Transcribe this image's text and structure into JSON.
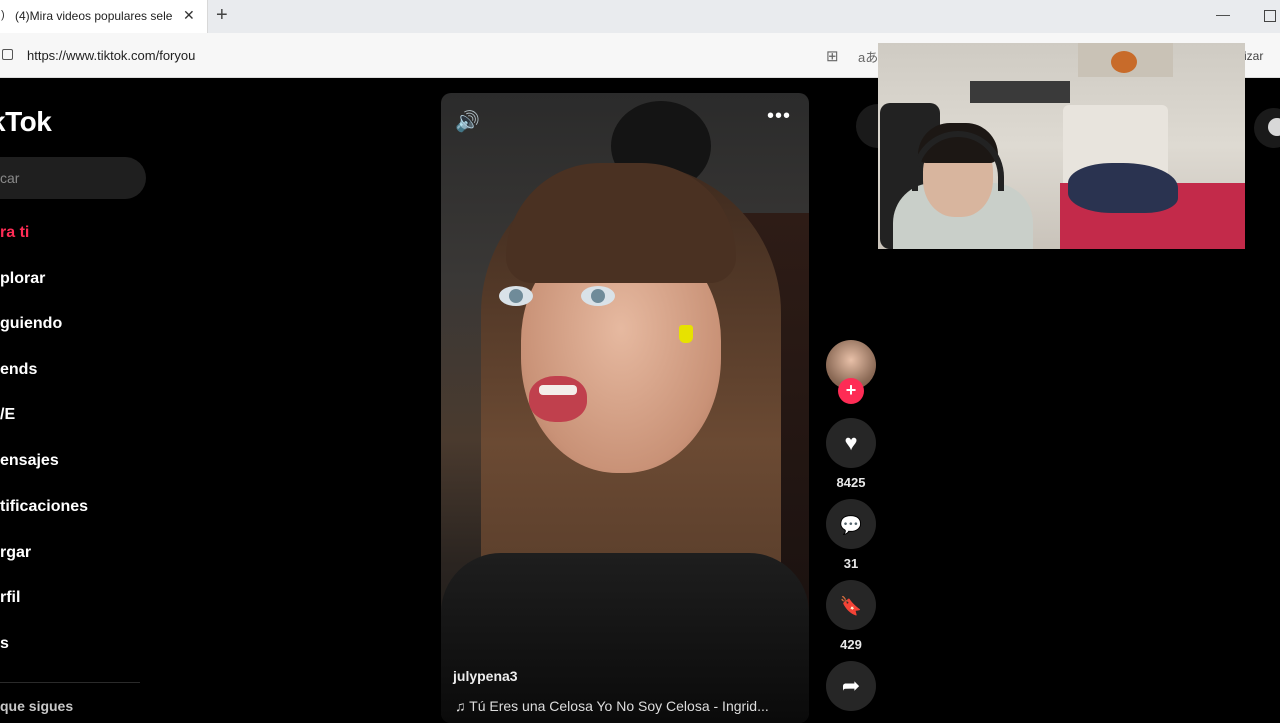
{
  "browser": {
    "tab_title": "(4)Mira videos populares sele",
    "tab_close": "✕",
    "new_tab": "+",
    "url": "https://www.tiktok.com/foryou",
    "ext_reader": "aあ",
    "right_partial": "izar"
  },
  "tiktok": {
    "logo": "kTok",
    "search_placeholder": "car",
    "nav": [
      {
        "label": "ra ti"
      },
      {
        "label": "plorar"
      },
      {
        "label": "guiendo"
      },
      {
        "label": "ends"
      },
      {
        "label": "/E"
      },
      {
        "label": "ensajes"
      },
      {
        "label": "tificaciones"
      },
      {
        "label": "rgar"
      },
      {
        "label": "rfil"
      },
      {
        "label": "s"
      }
    ],
    "following_header": "que sigues"
  },
  "video": {
    "username": "julypena3",
    "song": "♫  Tú Eres una Celosa Yo No Soy Celosa - Ingrid...",
    "likes": "8425",
    "comments": "31",
    "saves": "429"
  },
  "icons": {
    "volume": "🔊",
    "more": "•••",
    "heart": "♥",
    "comment": "💬",
    "bookmark": "🔖",
    "share": "➦",
    "plus": "+"
  },
  "colors": {
    "accent": "#fe2c55",
    "background": "#000000"
  }
}
